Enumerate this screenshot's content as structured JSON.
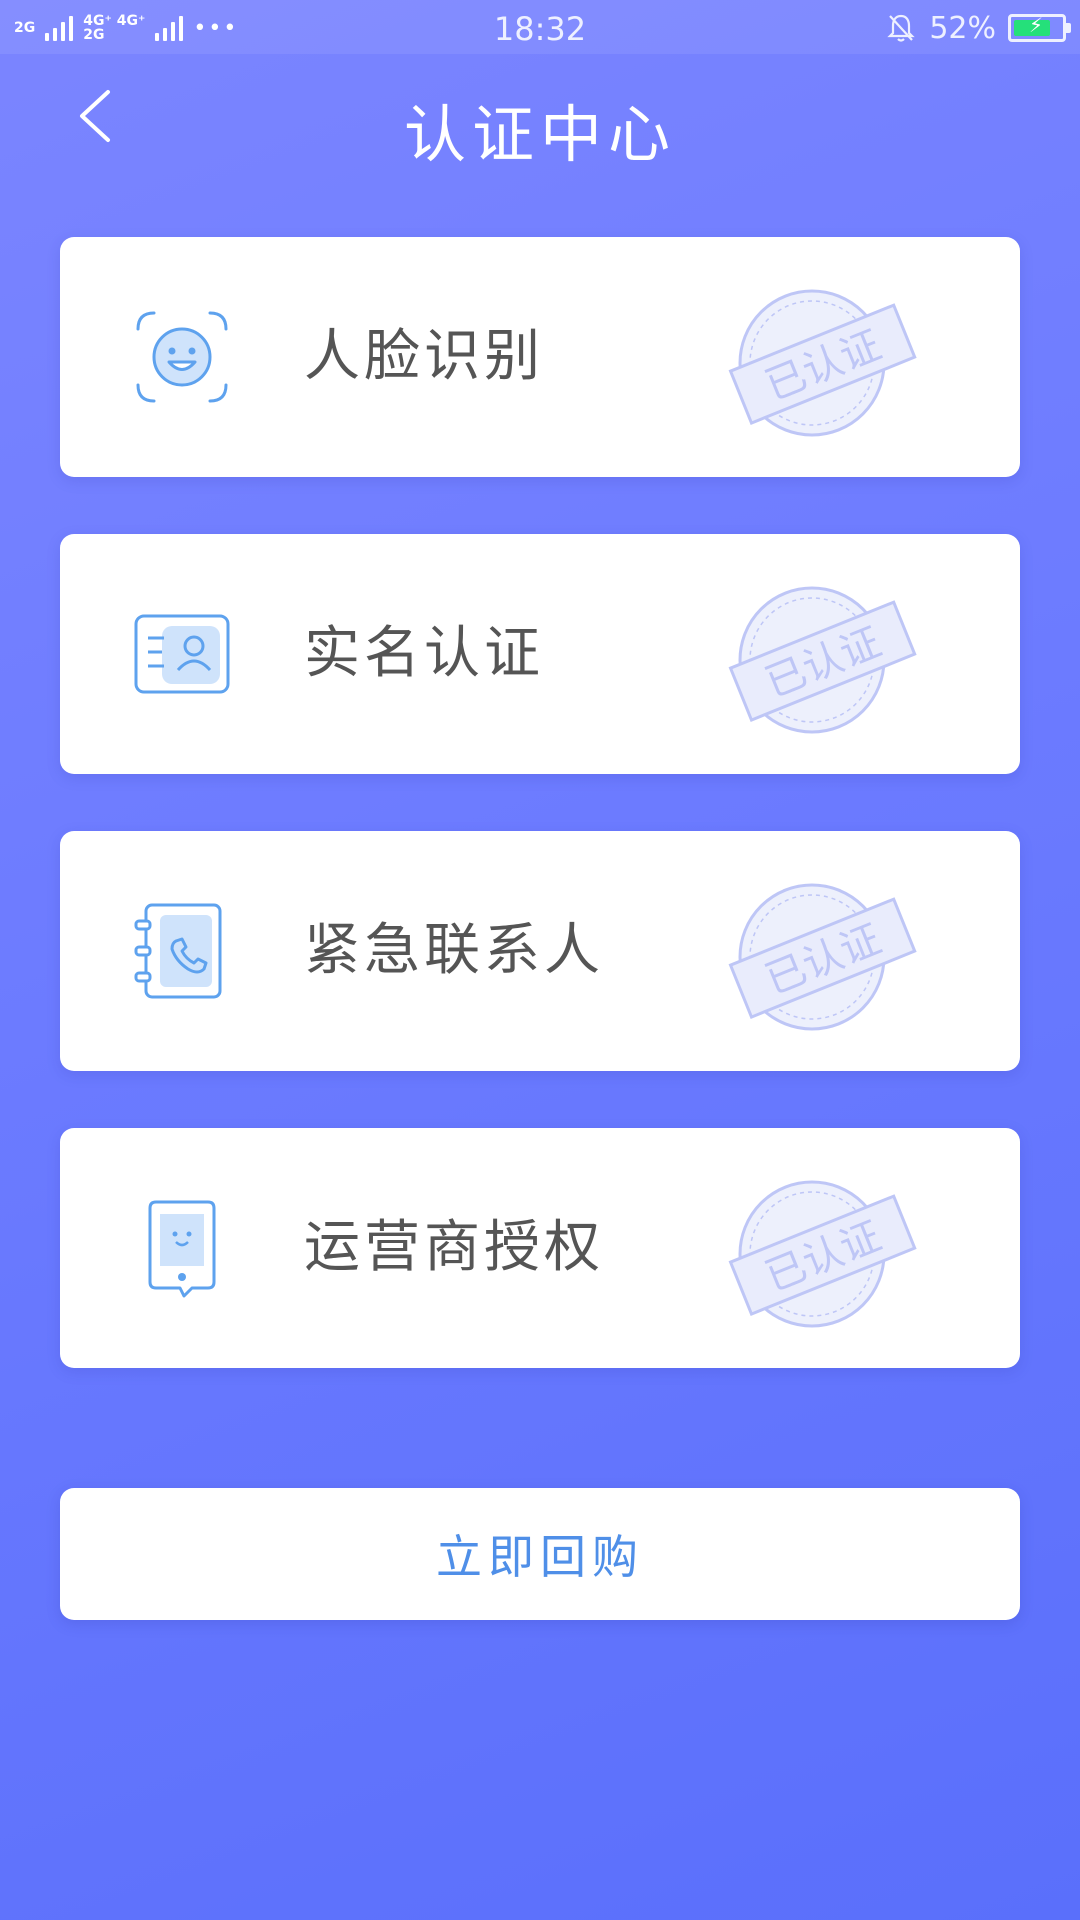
{
  "status_bar": {
    "network_left": "2G",
    "network_mid": "4G⁺ 4G⁺",
    "network_mid2": "2G",
    "time": "18:32",
    "battery": "52%",
    "icons": [
      "signal-icon",
      "more-dots-icon",
      "alarm-off-icon",
      "battery-charging-icon"
    ]
  },
  "header": {
    "title": "认证中心",
    "back_icon": "chevron-left-icon"
  },
  "cards": [
    {
      "label": "人脸识别",
      "icon": "face-scan-icon",
      "stamp": "已认证"
    },
    {
      "label": "实名认证",
      "icon": "id-card-icon",
      "stamp": "已认证"
    },
    {
      "label": "紧急联系人",
      "icon": "contact-book-icon",
      "stamp": "已认证"
    },
    {
      "label": "运营商授权",
      "icon": "phone-carrier-icon",
      "stamp": "已认证"
    }
  ],
  "action_button": {
    "label": "立即回购"
  },
  "colors": {
    "background": "#6c7bff",
    "accent": "#4f8fe8",
    "icon": "#5ea2ee",
    "stamp": "#8a98f0"
  }
}
